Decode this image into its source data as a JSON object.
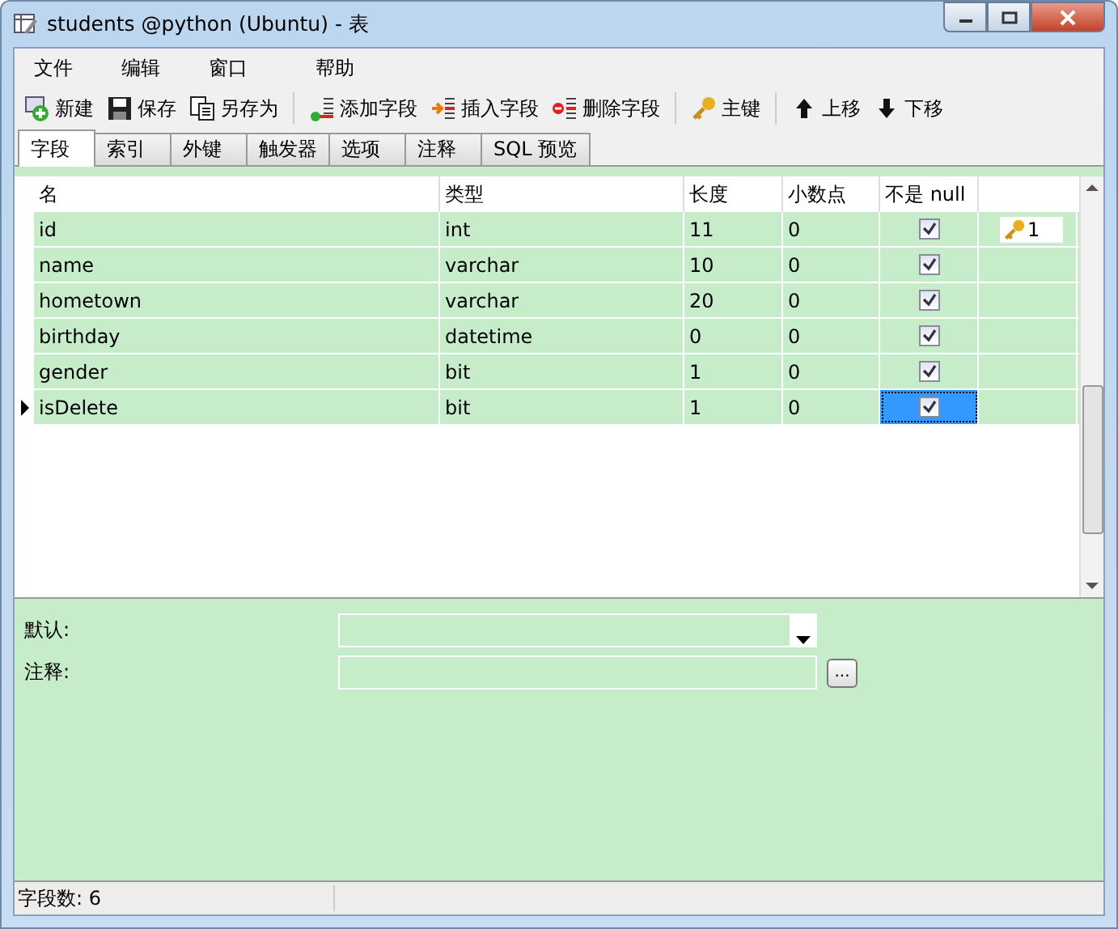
{
  "window": {
    "title": "students @python (Ubuntu) - 表"
  },
  "menu": [
    "文件",
    "编辑",
    "窗口",
    "帮助"
  ],
  "toolbar": [
    {
      "label": "新建",
      "kind": "new"
    },
    {
      "label": "保存",
      "kind": "save"
    },
    {
      "label": "另存为",
      "kind": "saveas"
    },
    {
      "label": "添加字段",
      "kind": "add"
    },
    {
      "label": "插入字段",
      "kind": "insert"
    },
    {
      "label": "删除字段",
      "kind": "delete"
    },
    {
      "label": "主键",
      "kind": "key"
    },
    {
      "label": "上移",
      "kind": "up"
    },
    {
      "label": "下移",
      "kind": "down"
    }
  ],
  "tabs": [
    {
      "label": "字段",
      "selected": true
    },
    {
      "label": "索引",
      "selected": false
    },
    {
      "label": "外键",
      "selected": false
    },
    {
      "label": "触发器",
      "selected": false
    },
    {
      "label": "选项",
      "selected": false
    },
    {
      "label": "注释",
      "selected": false
    },
    {
      "label": "SQL 预览",
      "selected": false
    }
  ],
  "table": {
    "columns": [
      "名",
      "类型",
      "长度",
      "小数点",
      "不是 null"
    ],
    "rows": [
      {
        "name": "id",
        "type": "int",
        "length": "11",
        "decimals": "0",
        "not_null": true,
        "key": "1",
        "selected": false
      },
      {
        "name": "name",
        "type": "varchar",
        "length": "10",
        "decimals": "0",
        "not_null": true,
        "selected": false
      },
      {
        "name": "hometown",
        "type": "varchar",
        "length": "20",
        "decimals": "0",
        "not_null": true,
        "selected": false
      },
      {
        "name": "birthday",
        "type": "datetime",
        "length": "0",
        "decimals": "0",
        "not_null": true,
        "selected": false
      },
      {
        "name": "gender",
        "type": "bit",
        "length": "1",
        "decimals": "0",
        "not_null": true,
        "selected": false
      },
      {
        "name": "isDelete",
        "type": "bit",
        "length": "1",
        "decimals": "0",
        "not_null": true,
        "selected": true
      }
    ]
  },
  "properties": [
    {
      "label": "默认:",
      "kind": "dropdown"
    },
    {
      "label": "注释:",
      "kind": "text"
    }
  ],
  "browse_button": "...",
  "status_bar": "字段数: 6"
}
